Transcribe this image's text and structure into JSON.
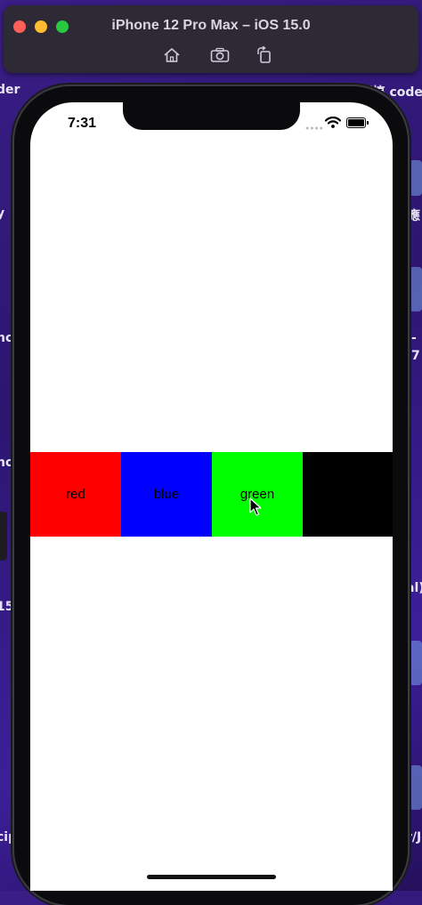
{
  "window": {
    "title": "iPhone 12 Pro Max – iOS 15.0",
    "toolbar": [
      "home-icon",
      "screenshot-icon",
      "rotate-icon"
    ]
  },
  "desktop": {
    "fragments": [
      "der",
      "y",
      "nc",
      "no",
      "15",
      "cip",
      "UI爆搞 code",
      "應",
      "-",
      "7",
      "al)",
      "r/Jo"
    ]
  },
  "status_bar": {
    "time": "7:31"
  },
  "stack_view": {
    "cells": [
      {
        "label": "red",
        "color": "#ff0000"
      },
      {
        "label": "blue",
        "color": "#0000ff"
      },
      {
        "label": "green",
        "color": "#00ff00"
      },
      {
        "label": "",
        "color": "#000000"
      }
    ]
  }
}
